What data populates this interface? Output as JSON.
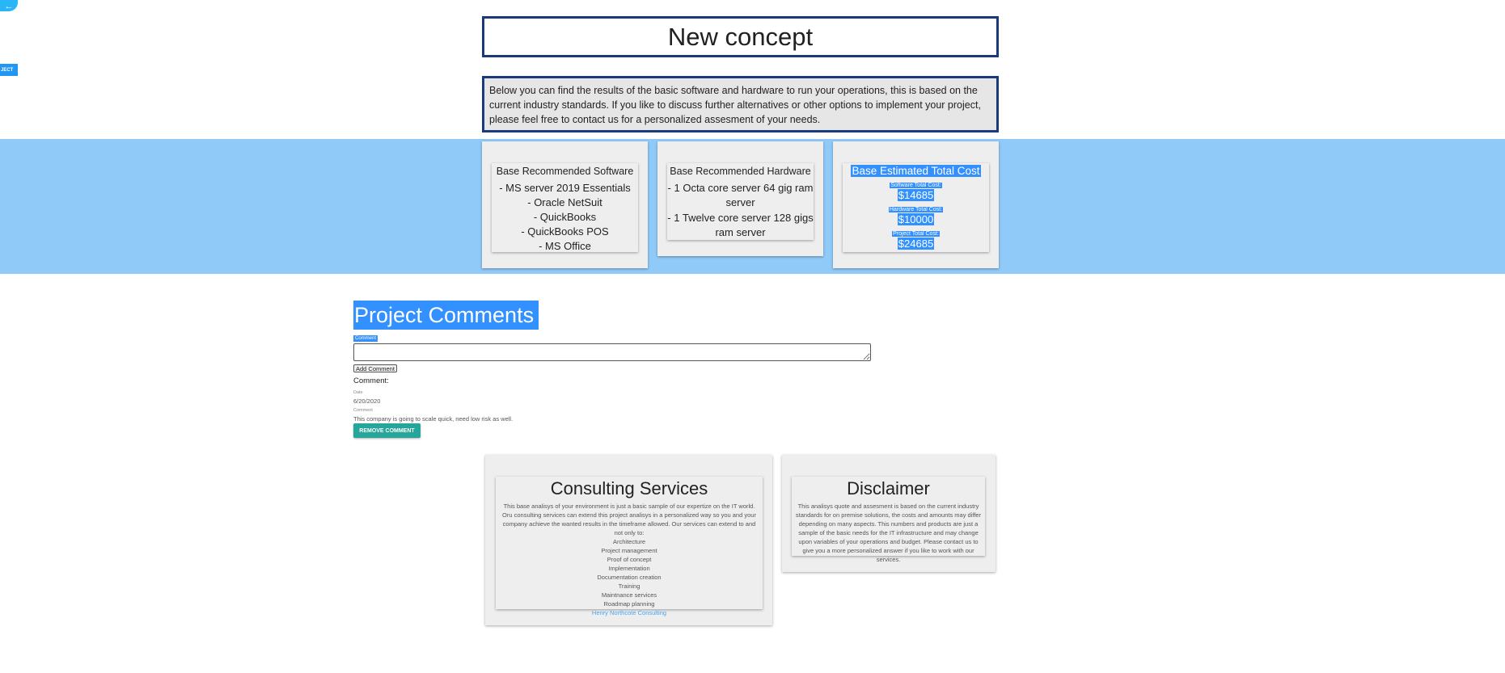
{
  "nav": {
    "back_icon": "arrow-left-icon",
    "side_button": "JECT"
  },
  "header": {
    "title": "New concept",
    "intro": "Below you can find the results of the basic software and hardware to run your operations, this is based on the current industry standards. If you like to discuss further alternatives or other options to implement your project, please feel free to contact us for a personalized assesment of your needs."
  },
  "software": {
    "heading": "Base Recommended Software",
    "items": [
      "- MS server 2019 Essentials",
      "- Oracle NetSuit",
      "- QuickBooks",
      "- QuickBooks POS",
      "- MS Office"
    ]
  },
  "hardware": {
    "heading": "Base Recommended Hardware",
    "items": [
      "- 1 Octa core server 64 gig ram server",
      "- 1 Twelve core server 128 gigs ram server"
    ]
  },
  "cost": {
    "heading": "Base Estimated Total Cost",
    "software_label": "Software Total Cost:",
    "software_value": "$14685",
    "hardware_label": "Hardware Total Cost:",
    "hardware_value": "$10000",
    "project_label": "Project Total Cost:",
    "project_value": "$24685"
  },
  "comments": {
    "title": "Project Comments",
    "field_label": "Comment",
    "textarea_value": "",
    "add_button": "Add Comment",
    "list_heading": "Comment:",
    "date_label": "Date",
    "date_value": "6/20/2020",
    "comment_label": "Comment",
    "comment_value": "This company is going to scale quick, need low risk as well.",
    "remove_button": "REMOVE COMMENT"
  },
  "consulting": {
    "title": "Consulting Services",
    "text": "This base analisys of your environment is just a basic sample of our expertize on the IT world. Oru consulting services can extend this project analisys in a personalized way so you and your company achieve the wanted results in the timeframe allowed. Our services can extend to and not only to:",
    "services": [
      "Architecture",
      "Project management",
      "Proof of concept",
      "Implementation",
      "Documentation creation",
      "Training",
      "Maintnance services",
      "Roadmap planning"
    ],
    "link": "Henry Northcote Consulting"
  },
  "disclaimer": {
    "title": "Disclaimer",
    "text": "This analisys quote and assesment is based on the current industry standards for on premise solutions, the costs and amounts may differ depending on many aspects. This numbers and products are just a sample of the basic needs for the IT infrastructure and may change upon variables of your operations and budget. Please contact us to give you a more personalized answer if you like to work with our services."
  },
  "colors": {
    "accent": "#2196f3",
    "band": "#90caf9",
    "border": "#1a3a7a",
    "selection": "#3390ff",
    "remove_button": "#26a69a"
  }
}
